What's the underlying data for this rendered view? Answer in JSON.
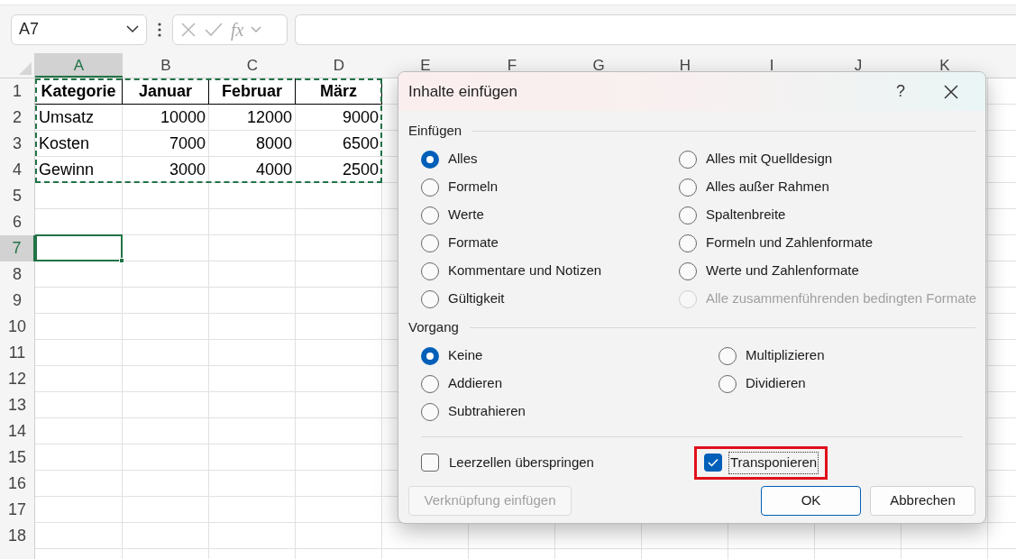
{
  "name_box": {
    "value": "A7"
  },
  "formula_bar": {
    "function_label": "fx"
  },
  "sheet": {
    "marquee": true,
    "columns": [
      {
        "label": "A",
        "selected": true
      },
      {
        "label": "B",
        "selected": false
      },
      {
        "label": "C",
        "selected": false
      },
      {
        "label": "D",
        "selected": false
      },
      {
        "label": "E",
        "selected": false
      },
      {
        "label": "F",
        "selected": false
      },
      {
        "label": "G",
        "selected": false
      },
      {
        "label": "H",
        "selected": false
      },
      {
        "label": "I",
        "selected": false
      },
      {
        "label": "J",
        "selected": false
      },
      {
        "label": "K",
        "selected": false
      }
    ],
    "rows": [
      {
        "label": "1",
        "selected": false,
        "header": true,
        "cells": [
          "Kategorie",
          "Januar",
          "Februar",
          "März"
        ]
      },
      {
        "label": "2",
        "selected": false,
        "header": false,
        "cells": [
          "Umsatz",
          "10000",
          "12000",
          "9000"
        ]
      },
      {
        "label": "3",
        "selected": false,
        "header": false,
        "cells": [
          "Kosten",
          "7000",
          "8000",
          "6500"
        ]
      },
      {
        "label": "4",
        "selected": false,
        "header": false,
        "cells": [
          "Gewinn",
          "3000",
          "4000",
          "2500"
        ]
      },
      {
        "label": "5",
        "selected": false
      },
      {
        "label": "6",
        "selected": false
      },
      {
        "label": "7",
        "selected": true
      },
      {
        "label": "8",
        "selected": false
      },
      {
        "label": "9",
        "selected": false
      },
      {
        "label": "10",
        "selected": false
      },
      {
        "label": "11",
        "selected": false
      },
      {
        "label": "12",
        "selected": false
      },
      {
        "label": "13",
        "selected": false
      },
      {
        "label": "14",
        "selected": false
      },
      {
        "label": "15",
        "selected": false
      },
      {
        "label": "16",
        "selected": false
      },
      {
        "label": "17",
        "selected": false
      },
      {
        "label": "18",
        "selected": false
      }
    ]
  },
  "dialog": {
    "title": "Inhalte einfügen",
    "help": "?",
    "sections": [
      {
        "title": "Einfügen",
        "options": [
          {
            "label": "Alles",
            "selected": true,
            "disabled": false
          },
          {
            "label": "Alles mit Quelldesign",
            "selected": false,
            "disabled": false
          },
          {
            "label": "Formeln",
            "selected": false,
            "disabled": false
          },
          {
            "label": "Alles außer Rahmen",
            "selected": false,
            "disabled": false
          },
          {
            "label": "Werte",
            "selected": false,
            "disabled": false
          },
          {
            "label": "Spaltenbreite",
            "selected": false,
            "disabled": false
          },
          {
            "label": "Formate",
            "selected": false,
            "disabled": false
          },
          {
            "label": "Formeln und Zahlenformate",
            "selected": false,
            "disabled": false
          },
          {
            "label": "Kommentare und Notizen",
            "selected": false,
            "disabled": false
          },
          {
            "label": "Werte und Zahlenformate",
            "selected": false,
            "disabled": false
          },
          {
            "label": "Gültigkeit",
            "selected": false,
            "disabled": false
          },
          {
            "label": "Alle zusammenführenden bedingten Formate",
            "selected": false,
            "disabled": true
          }
        ]
      },
      {
        "title": "Vorgang",
        "options": [
          {
            "label": "Keine",
            "selected": true,
            "disabled": false
          },
          {
            "label": "Multiplizieren",
            "selected": false,
            "disabled": false
          },
          {
            "label": "Addieren",
            "selected": false,
            "disabled": false
          },
          {
            "label": "Dividieren",
            "selected": false,
            "disabled": false
          },
          {
            "label": "Subtrahieren",
            "selected": false,
            "disabled": false
          }
        ]
      }
    ],
    "checkboxes": [
      {
        "label": "Leerzellen überspringen",
        "checked": false,
        "highlighted": false,
        "focused": false
      },
      {
        "label": "Transponieren",
        "checked": true,
        "highlighted": true,
        "focused": true
      }
    ],
    "buttons": [
      {
        "label": "Verknüpfung einfügen",
        "disabled": true,
        "default": false
      },
      {
        "label": "OK",
        "disabled": false,
        "default": true
      },
      {
        "label": "Abbrechen",
        "disabled": false,
        "default": false
      }
    ]
  }
}
